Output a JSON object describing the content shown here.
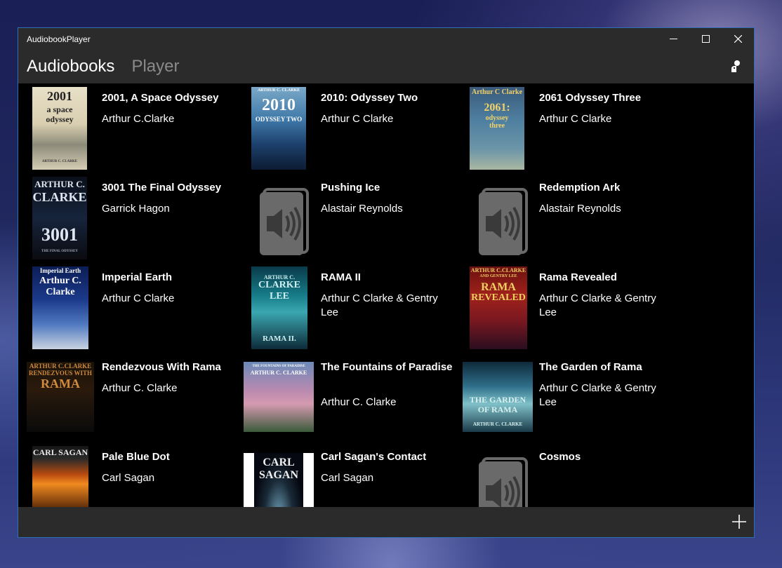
{
  "window": {
    "title": "AudiobookPlayer"
  },
  "tabs": [
    {
      "label": "Audiobooks",
      "active": true
    },
    {
      "label": "Player",
      "active": false
    }
  ],
  "icons": {
    "minimize": "minimize-icon",
    "maximize": "maximize-icon",
    "close": "close-icon",
    "header_action": "person-icon",
    "add": "plus-icon",
    "placeholder": "speaker-book-icon"
  },
  "colors": {
    "accent_border": "#2f6fb8",
    "chrome": "#2b2b2b",
    "content_bg": "#000000"
  },
  "books": [
    {
      "title": "2001, A Space Odyssey",
      "author": "Arthur C.Clarke",
      "cover": "2001"
    },
    {
      "title": "2010: Odyssey Two",
      "author": "Arthur C Clarke",
      "cover": "2010"
    },
    {
      "title": "2061 Odyssey Three",
      "author": "Arthur C Clarke",
      "cover": "2061"
    },
    {
      "title": "3001 The Final Odyssey",
      "author": "Garrick Hagon",
      "cover": "3001"
    },
    {
      "title": "Pushing Ice",
      "author": "Alastair Reynolds",
      "cover": "placeholder"
    },
    {
      "title": "Redemption Ark",
      "author": "Alastair Reynolds",
      "cover": "placeholder"
    },
    {
      "title": "Imperial Earth",
      "author": "Arthur C Clarke",
      "cover": "imperial"
    },
    {
      "title": "RAMA II",
      "author": "Arthur C Clarke & Gentry Lee",
      "cover": "rama2"
    },
    {
      "title": "Rama Revealed",
      "author": "Arthur C Clarke & Gentry Lee",
      "cover": "ramarev"
    },
    {
      "title": "Rendezvous With Rama",
      "author": "Arthur C. Clarke",
      "cover": "rendezvous"
    },
    {
      "title": "The Fountains of Paradise",
      "author": "Arthur C. Clarke",
      "cover": "fountains"
    },
    {
      "title": "The Garden of Rama",
      "author": "Arthur C Clarke & Gentry Lee",
      "cover": "garden"
    },
    {
      "title": "Pale Blue Dot",
      "author": "Carl Sagan",
      "cover": "paleblue"
    },
    {
      "title": "Carl Sagan's Contact",
      "author": "Carl Sagan",
      "cover": "contact"
    },
    {
      "title": "Cosmos",
      "author": "",
      "cover": "placeholder"
    }
  ],
  "cover_text": {
    "c2001": [
      "2001",
      "a space",
      "odyssey",
      "ARTHUR C. CLARKE"
    ],
    "c2010": [
      "ARTHUR C. CLARKE",
      "2010",
      "ODYSSEY TWO"
    ],
    "c2061": [
      "Arthur C Clarke",
      "2061:",
      "odyssey",
      "three"
    ],
    "c3001": [
      "ARTHUR C.",
      "CLARKE",
      "3001",
      "THE FINAL ODYSSEY"
    ],
    "imperial": [
      "Imperial Earth",
      "Arthur C.",
      "Clarke"
    ],
    "rama2": [
      "ARTHUR C.",
      "CLARKE",
      "LEE",
      "RAMA II."
    ],
    "ramarev": [
      "ARTHUR C.CLARKE",
      "AND GENTRY LEE",
      "RAMA",
      "REVEALED"
    ],
    "rendezvous": [
      "ARTHUR C.CLARKE",
      "RENDEZVOUS WITH",
      "RAMA"
    ],
    "fountains": [
      "THE FOUNTAINS OF PARADISE",
      "ARTHUR C. CLARKE"
    ],
    "garden": [
      "THE GARDEN",
      "OF RAMA",
      "ARTHUR C. CLARKE"
    ],
    "paleblue": [
      "CARL SAGAN"
    ],
    "contact": [
      "CARL",
      "SAGAN"
    ]
  }
}
